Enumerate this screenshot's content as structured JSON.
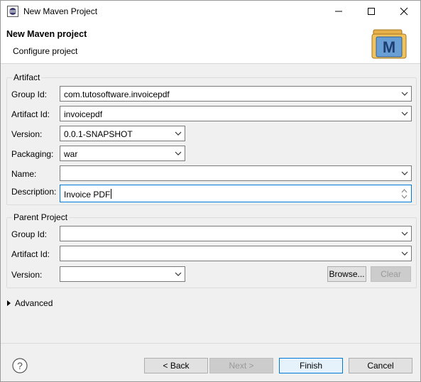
{
  "window": {
    "title": "New Maven Project"
  },
  "header": {
    "title": "New Maven project",
    "subtitle": "Configure project",
    "logo_letter": "M"
  },
  "artifact": {
    "legend": "Artifact",
    "group_id_label": "Group Id:",
    "group_id_value": "com.tutosoftware.invoicepdf",
    "artifact_id_label": "Artifact Id:",
    "artifact_id_value": "invoicepdf",
    "version_label": "Version:",
    "version_value": "0.0.1-SNAPSHOT",
    "packaging_label": "Packaging:",
    "packaging_value": "war",
    "name_label": "Name:",
    "name_value": "",
    "description_label": "Description:",
    "description_value": "Invoice PDF"
  },
  "parent": {
    "legend": "Parent Project",
    "group_id_label": "Group Id:",
    "group_id_value": "",
    "artifact_id_label": "Artifact Id:",
    "artifact_id_value": "",
    "version_label": "Version:",
    "version_value": "",
    "browse_label": "Browse...",
    "clear_label": "Clear"
  },
  "advanced": {
    "label": "Advanced"
  },
  "footer": {
    "back_label": "< Back",
    "next_label": "Next >",
    "finish_label": "Finish",
    "cancel_label": "Cancel"
  },
  "icons": {
    "app": "eclipse-icon",
    "minimize": "minimize-icon",
    "maximize": "maximize-icon",
    "close": "close-icon",
    "help": "help-icon",
    "logo": "maven-logo-icon"
  },
  "colors": {
    "accent": "#0078d7",
    "background": "#f0f0f0"
  }
}
